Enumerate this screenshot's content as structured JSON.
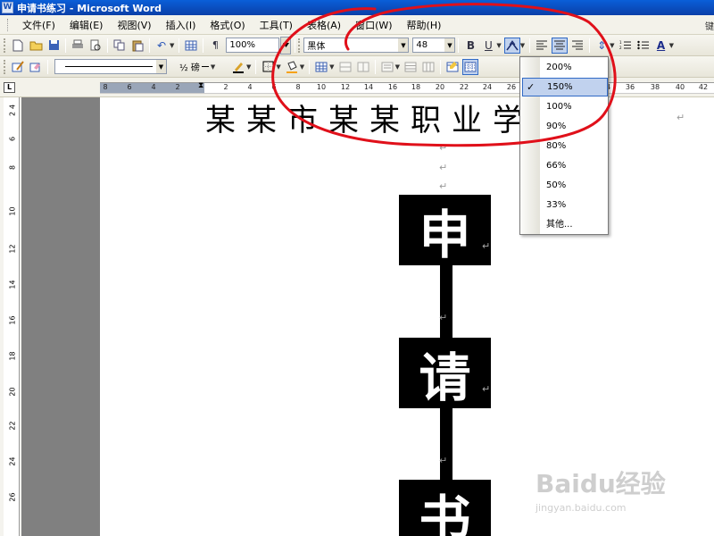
{
  "window": {
    "title": "申请书练习 - Microsoft Word"
  },
  "menu": [
    "文件(F)",
    "编辑(E)",
    "视图(V)",
    "插入(I)",
    "格式(O)",
    "工具(T)",
    "表格(A)",
    "窗口(W)",
    "帮助(H)"
  ],
  "menu_overflow": "键",
  "toolbar": {
    "zoom_value": "100%",
    "font_name": "黑体",
    "font_size": "48",
    "bold": "B",
    "underline": "U",
    "line_weight": "½ 磅",
    "font_color": "A"
  },
  "ruler": {
    "top_ticks": [
      "8",
      "6",
      "4",
      "2",
      "2",
      "4",
      "6",
      "8",
      "10",
      "12",
      "14",
      "16",
      "18",
      "20",
      "22",
      "24",
      "26",
      "28",
      "30",
      "32",
      "34",
      "36",
      "38",
      "40",
      "42"
    ],
    "left_ticks": [
      "4",
      "2",
      "6",
      "8",
      "10",
      "12",
      "14",
      "16",
      "18",
      "20",
      "22",
      "24",
      "26"
    ]
  },
  "document": {
    "school_line": "某某市某某职业学校",
    "vertical_title": [
      "申",
      "请",
      "书"
    ],
    "para_mark": "↵"
  },
  "zoom_menu": {
    "options": [
      "200%",
      "150%",
      "100%",
      "90%",
      "80%",
      "66%",
      "50%",
      "33%",
      "其他..."
    ],
    "selected": "150%"
  },
  "watermark": {
    "logo": "Baidu经验",
    "url": "jingyan.baidu.com"
  },
  "colors": {
    "annotation": "#e0101a",
    "titlebar": "#0a4fc8",
    "selection": "#c1d2ee"
  }
}
